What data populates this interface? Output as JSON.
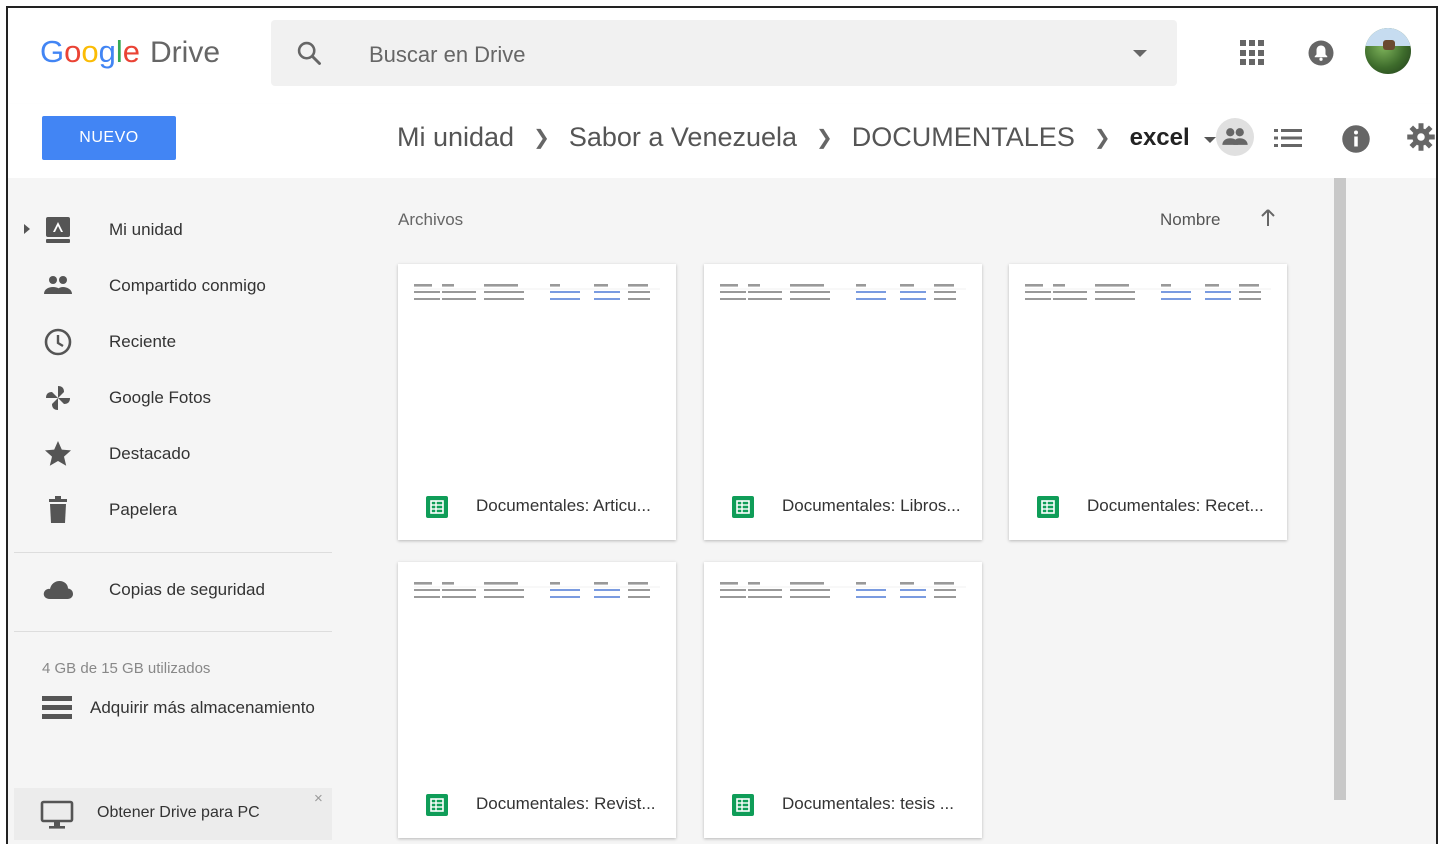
{
  "header": {
    "logo_google": "Google",
    "logo_drive": "Drive",
    "search_placeholder": "Buscar en Drive"
  },
  "toolbar": {
    "new_button": "NUEVO",
    "breadcrumb": [
      {
        "label": "Mi unidad"
      },
      {
        "label": "Sabor a Venezuela"
      },
      {
        "label": "DOCUMENTALES"
      }
    ],
    "current_folder": "excel"
  },
  "sidebar": {
    "items": [
      {
        "label": "Mi unidad",
        "icon": "drive-icon"
      },
      {
        "label": "Compartido conmigo",
        "icon": "people-icon"
      },
      {
        "label": "Reciente",
        "icon": "clock-icon"
      },
      {
        "label": "Google Fotos",
        "icon": "pinwheel-icon"
      },
      {
        "label": "Destacado",
        "icon": "star-icon"
      },
      {
        "label": "Papelera",
        "icon": "trash-icon"
      },
      {
        "label": "Copias de seguridad",
        "icon": "cloud-icon"
      }
    ],
    "storage": "4 GB de 15 GB utilizados",
    "buy_storage": "Adquirir más almacenamiento",
    "get_drive": "Obtener Drive para PC",
    "close": "×"
  },
  "content": {
    "section_title": "Archivos",
    "sort_label": "Nombre",
    "files": [
      {
        "name": "Documentales: Articu..."
      },
      {
        "name": "Documentales: Libros..."
      },
      {
        "name": "Documentales: Recet..."
      },
      {
        "name": "Documentales: Revist..."
      },
      {
        "name": "Documentales: tesis ..."
      }
    ]
  },
  "colors": {
    "accent": "#4285f4",
    "sheets_green": "#0f9d58"
  }
}
